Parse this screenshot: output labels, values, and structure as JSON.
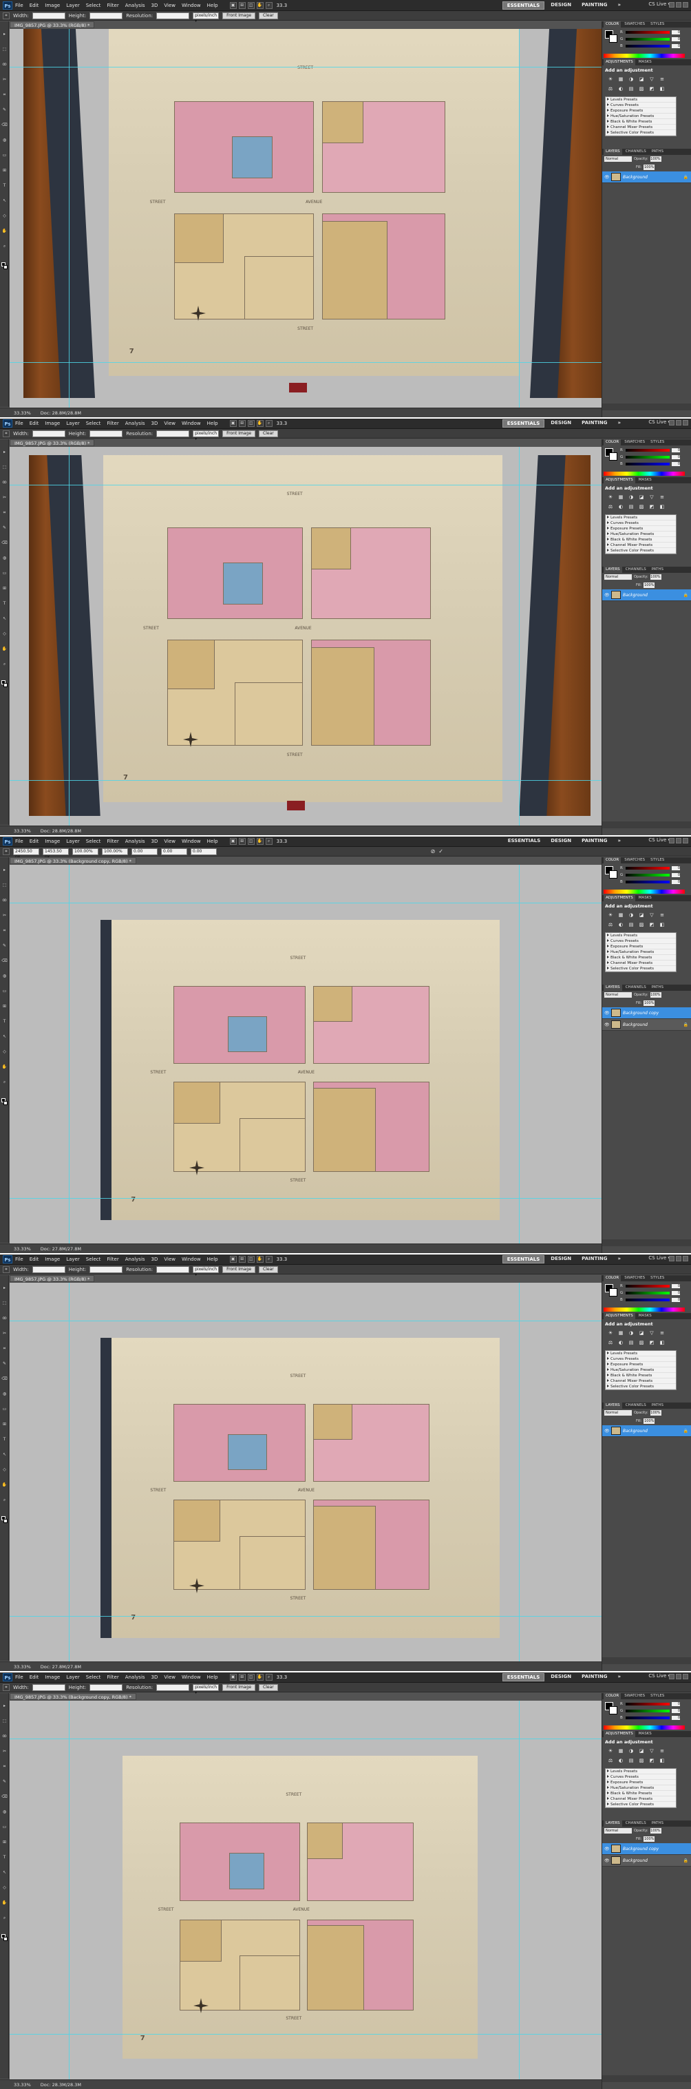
{
  "menu": {
    "logo": "Ps",
    "items": [
      "File",
      "Edit",
      "Image",
      "Layer",
      "Select",
      "Filter",
      "Analysis",
      "3D",
      "View",
      "Window",
      "Help"
    ],
    "zoom": "33.3"
  },
  "workspaces": [
    "ESSENTIALS",
    "DESIGN",
    "PAINTING",
    "»"
  ],
  "cs_live": "CS Live ▾",
  "options_crop": {
    "width_label": "Width:",
    "height_label": "Height:",
    "resolution_label": "Resolution:",
    "resolution_unit": "pixels/inch ▾",
    "front_image": "Front Image",
    "clear": "Clear"
  },
  "options_transform": {
    "x": "2450.50 px",
    "y": "1453.50 px",
    "w": "100.00%",
    "h": "100.00%",
    "angle": "0.00",
    "hskew": "0.00",
    "vskew": "0.00",
    "commit": [
      "⊘",
      "✓"
    ]
  },
  "frames": [
    {
      "doc_tab": "IMG_9857.JPG @ 33.3% (RGB/8) *",
      "status": "33.33%",
      "doc_size": "Doc: 28.8M/28.8M"
    },
    {
      "doc_tab": "IMG_9857.JPG @ 33.3% (RGB/8) *",
      "status": "33.33%",
      "doc_size": "Doc: 28.8M/28.8M"
    },
    {
      "doc_tab": "IMG_9857.JPG @ 33.3% (Background copy, RGB/8) *",
      "status": "33.33%",
      "doc_size": "Doc: 27.8M/27.8M"
    },
    {
      "doc_tab": "IMG_9857.JPG @ 33.3% (RGB/8) *",
      "status": "33.33%",
      "doc_size": "Doc: 27.8M/27.8M"
    },
    {
      "doc_tab": "IMG_9857.JPG @ 33.3% (Background copy, RGB/8) *",
      "status": "33.33%",
      "doc_size": "Doc: 28.3M/28.3M"
    }
  ],
  "panels": {
    "color_tabs": [
      "COLOR",
      "SWATCHES",
      "STYLES"
    ],
    "rgb": [
      {
        "letter": "R",
        "value": "0"
      },
      {
        "letter": "G",
        "value": "0"
      },
      {
        "letter": "B",
        "value": "0"
      }
    ],
    "adj_tabs": [
      "ADJUSTMENTS",
      "MASKS"
    ],
    "adj_title": "Add an adjustment",
    "adj_icons": [
      "☀",
      "▦",
      "◑",
      "◪",
      "▽",
      "≡",
      "⚖",
      "◐",
      "▤",
      "▨",
      "◩",
      "◧"
    ],
    "presets": [
      "Levels Presets",
      "Curves Presets",
      "Exposure Presets",
      "Hue/Saturation Presets",
      "Black & White Presets",
      "Channel Mixer Presets",
      "Selective Color Presets"
    ],
    "layer_tabs": [
      "LAYERS",
      "CHANNELS",
      "PATHS"
    ],
    "blend_mode": "Normal",
    "opacity_label": "Opacity:",
    "opacity": "100%",
    "fill_label": "Fill:",
    "fill": "100%",
    "layers_one": [
      "Background"
    ],
    "layers_two": [
      "Background copy",
      "Background"
    ]
  },
  "map": {
    "street_labels": [
      "STREET",
      "AVENUE",
      "STREET",
      "STREET"
    ],
    "sheet_number": "7"
  },
  "colors": {
    "accent": "#3b8fe0",
    "guide": "#4fd6e8"
  }
}
